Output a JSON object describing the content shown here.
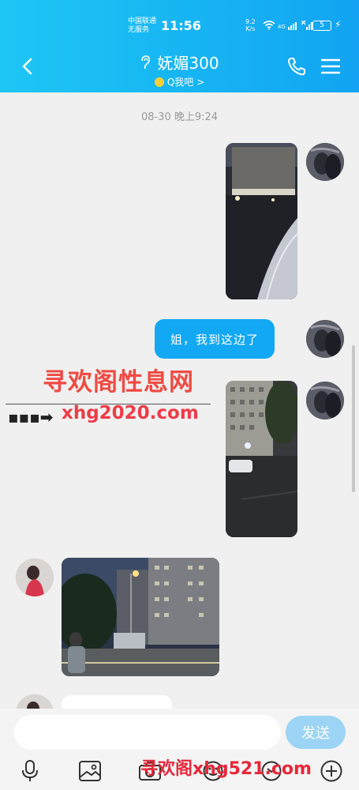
{
  "status_bar": {
    "carrier_line1": "中国联通",
    "carrier_line2": "无服务",
    "time": "11:56",
    "net_speed_value": "9.2",
    "net_speed_unit": "K/s",
    "network": "4G",
    "battery": "5"
  },
  "header": {
    "title": "妩媚300",
    "subtitle": "Q我吧 >",
    "back_icon": "back-arrow-icon",
    "call_icon": "phone-icon",
    "menu_icon": "menu-icon"
  },
  "chat": {
    "timestamp": "08-30 晚上9:24",
    "messages": [
      {
        "sender": "me",
        "type": "image",
        "content": "night street photo"
      },
      {
        "sender": "me",
        "type": "text",
        "text": "姐，我到这边了"
      },
      {
        "sender": "me",
        "type": "image",
        "content": "apartment parking lot photo"
      },
      {
        "sender": "peer",
        "type": "image",
        "content": "street view with buildings photo"
      },
      {
        "sender": "peer",
        "type": "text",
        "text": ""
      }
    ]
  },
  "watermark": {
    "line1": "寻欢阁性息网",
    "line2": "xhg2020.com",
    "line3": "寻欢阁xhg521.com"
  },
  "input_bar": {
    "placeholder": "",
    "send_label": "发送"
  },
  "toolbar": {
    "icons": [
      "mic-icon",
      "image-icon",
      "camera-icon",
      "emoji-icon",
      "plus-icon"
    ]
  },
  "colors": {
    "accent": "#12a8f3",
    "send_disabled": "#9bd4f5",
    "background": "#f0f0f0"
  }
}
